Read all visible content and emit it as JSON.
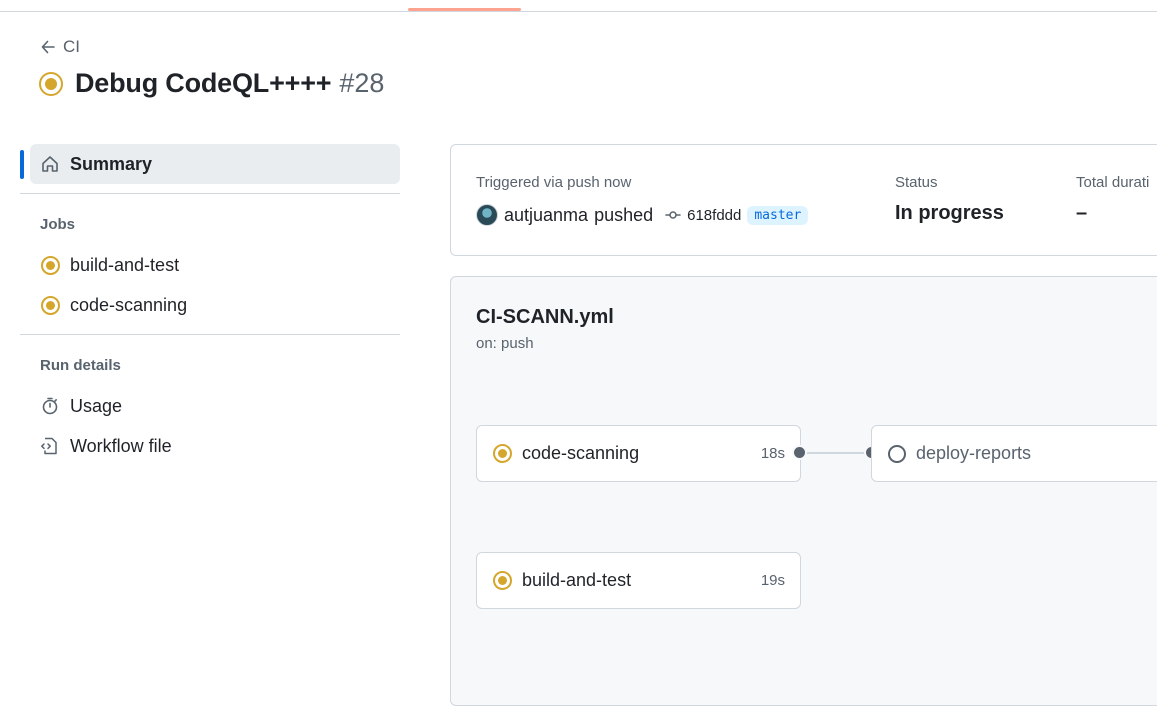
{
  "back": {
    "label": "CI"
  },
  "run": {
    "title": "Debug CodeQL++++",
    "number": "#28"
  },
  "sidebar": {
    "summary_label": "Summary",
    "jobs_title": "Jobs",
    "jobs": [
      {
        "label": "build-and-test",
        "status": "in_progress"
      },
      {
        "label": "code-scanning",
        "status": "in_progress"
      }
    ],
    "run_details_title": "Run details",
    "details": [
      {
        "label": "Usage",
        "icon": "stopwatch-icon"
      },
      {
        "label": "Workflow file",
        "icon": "file-code-icon"
      }
    ]
  },
  "summary": {
    "trigger_text": "Triggered via push now",
    "actor": "autjuanma",
    "verb": "pushed",
    "commit": "618fddd",
    "branch": "master",
    "status_label": "Status",
    "status_value": "In progress",
    "duration_label": "Total durati",
    "duration_value": "–"
  },
  "workflow": {
    "file": "CI-SCANN.yml",
    "trigger": "on: push",
    "jobs": [
      {
        "name": "code-scanning",
        "time": "18s",
        "status": "in_progress"
      },
      {
        "name": "deploy-reports",
        "time": "",
        "status": "queued"
      },
      {
        "name": "build-and-test",
        "time": "19s",
        "status": "in_progress"
      }
    ]
  },
  "colors": {
    "in_progress": "#d4a72c",
    "accent": "#0969da",
    "active_tab": "#fd8c73"
  }
}
